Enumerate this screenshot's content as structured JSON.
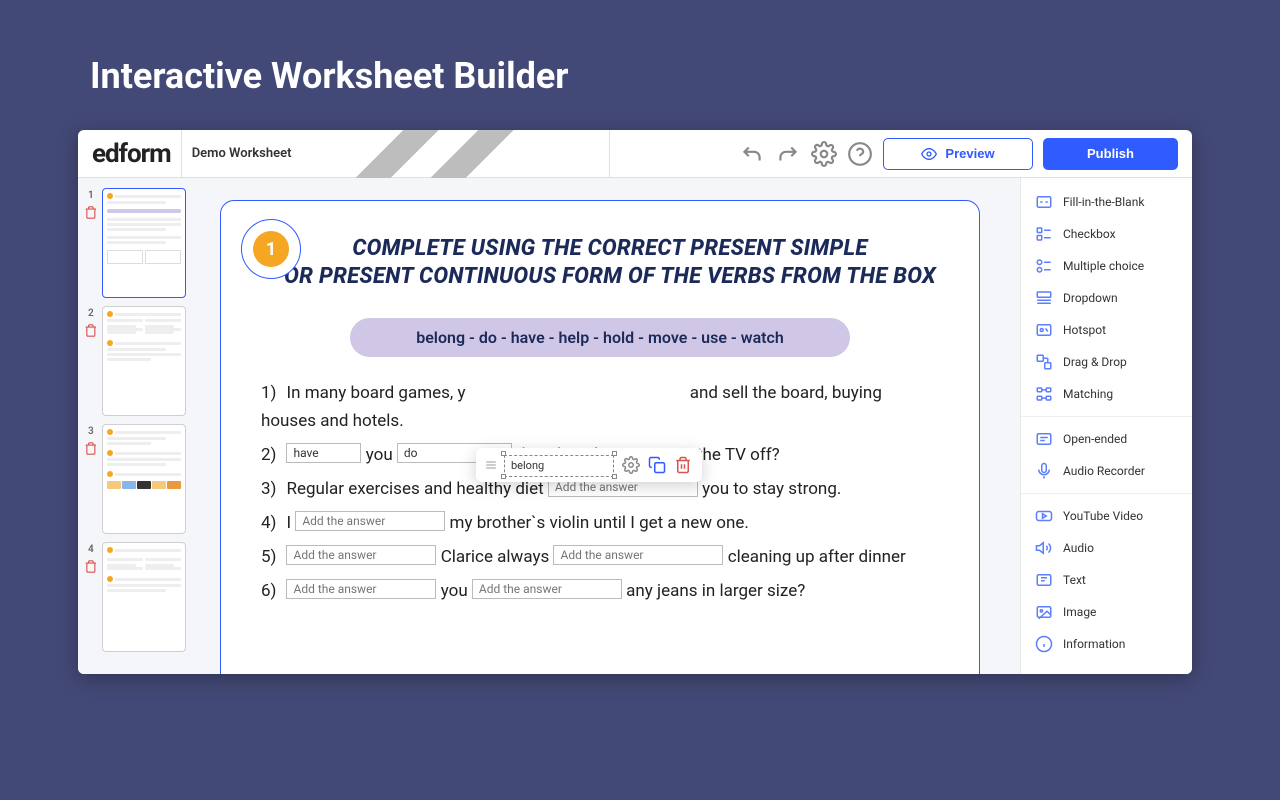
{
  "pageTitle": "Interactive Worksheet Builder",
  "logo": "edform",
  "worksheetTitle": "Demo Worksheet",
  "toolbar": {
    "preview": "Preview",
    "publish": "Publish"
  },
  "thumbs": [
    {
      "num": "1"
    },
    {
      "num": "2"
    },
    {
      "num": "3"
    },
    {
      "num": "4"
    }
  ],
  "canvas": {
    "badge": "1",
    "headingLine1": "COMPLETE USING THE CORRECT PRESENT SIMPLE",
    "headingLine2": "OR PRESENT CONTINUOUS FORM OF THE VERBS FROM THE BOX",
    "wordbox": "belong - do - have - help - hold - move - use - watch",
    "placeholder": "Add the answer",
    "selected": {
      "value": "belong"
    },
    "q1": {
      "n": "1)",
      "a": "In many board games, y",
      "b": " and sell the board, buying houses and hotels."
    },
    "q2": {
      "n": "2)",
      "f1": "have",
      "a": " you ",
      "f2": "do",
      "b": " this chanel or can I turn the TV off?"
    },
    "q3": {
      "n": "3)",
      "a": "Regular exercises and healthy diet ",
      "b": " you to stay strong."
    },
    "q4": {
      "n": "4)",
      "a": "I ",
      "b": " my brother`s violin until I get a new one."
    },
    "q5": {
      "n": "5)",
      "a": " Clarice always ",
      "b": " cleaning up after dinner"
    },
    "q6": {
      "n": "6)",
      "a": " you ",
      "b": " any jeans in larger size?"
    }
  },
  "panel": {
    "g1": [
      {
        "label": "Fill-in-the-Blank"
      },
      {
        "label": "Checkbox"
      },
      {
        "label": "Multiple choice"
      },
      {
        "label": "Dropdown"
      },
      {
        "label": "Hotspot"
      },
      {
        "label": "Drag & Drop"
      },
      {
        "label": "Matching"
      }
    ],
    "g2": [
      {
        "label": "Open-ended"
      },
      {
        "label": "Audio Recorder"
      }
    ],
    "g3": [
      {
        "label": "YouTube Video"
      },
      {
        "label": "Audio"
      },
      {
        "label": "Text"
      },
      {
        "label": "Image"
      },
      {
        "label": "Information"
      }
    ]
  }
}
